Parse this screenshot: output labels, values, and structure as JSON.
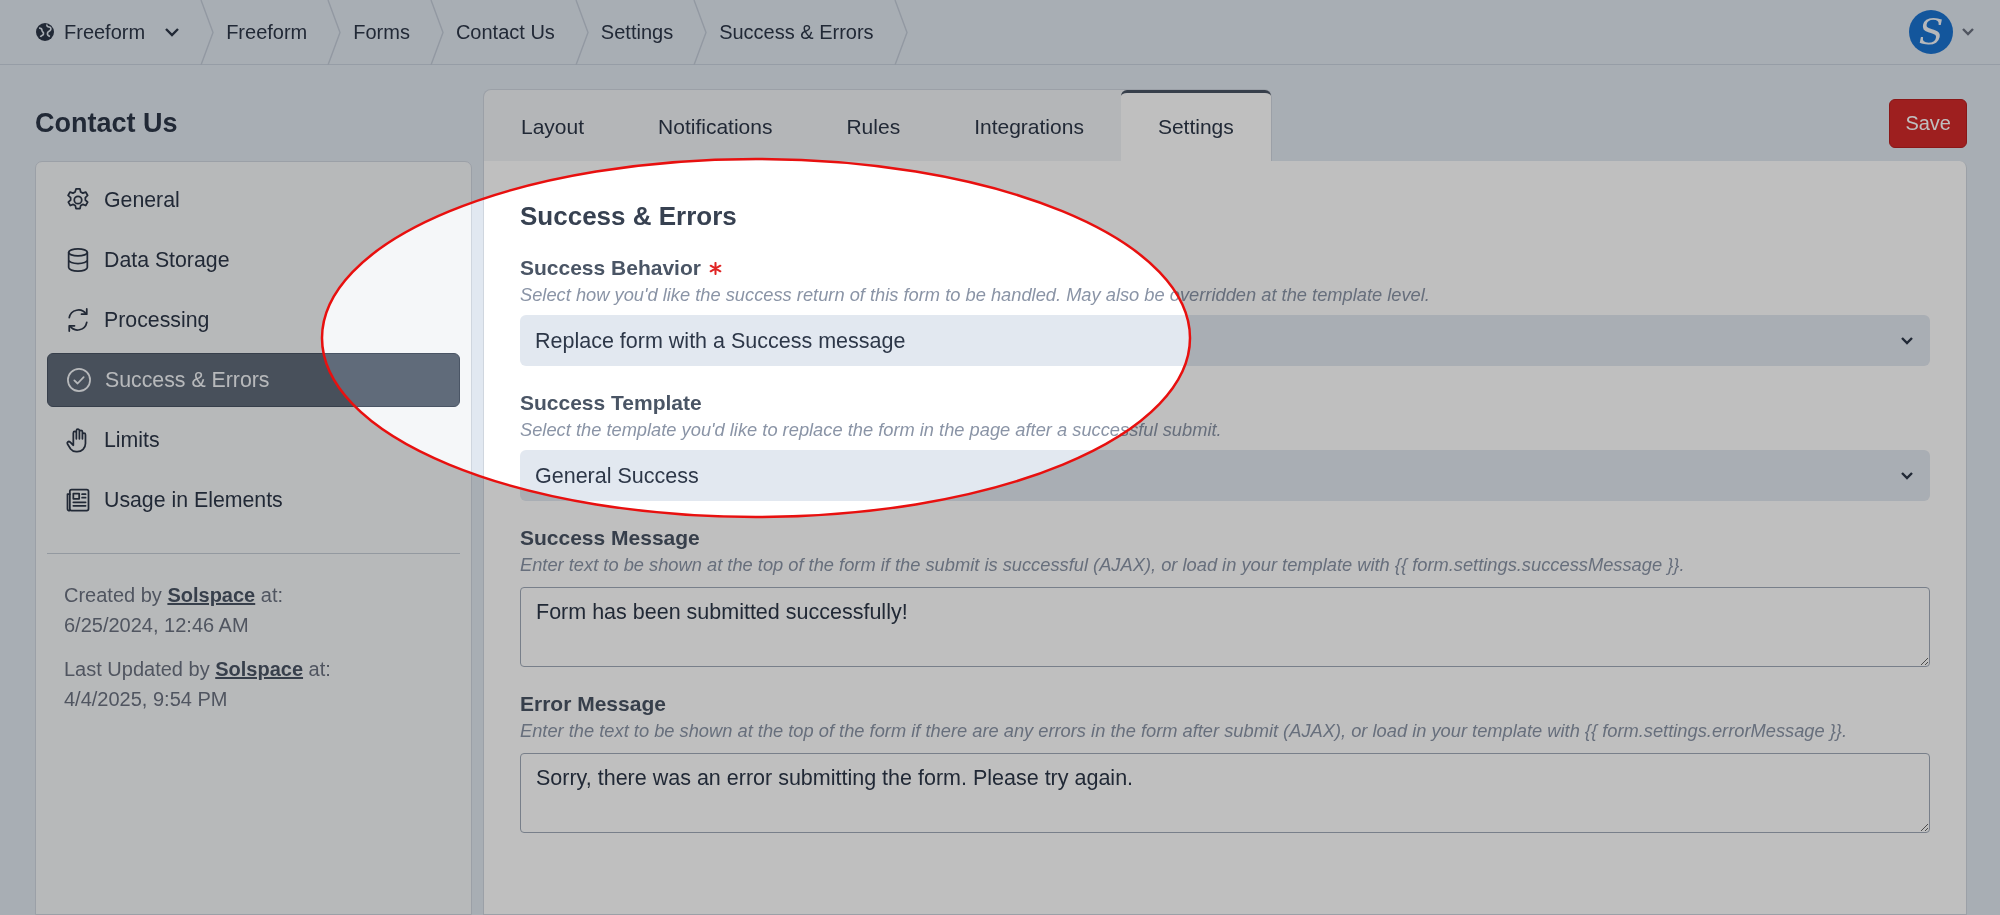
{
  "breadcrumbs": [
    {
      "kind": "site",
      "label": "Freeform"
    },
    {
      "kind": "crumb",
      "label": "Freeform"
    },
    {
      "kind": "crumb",
      "label": "Forms"
    },
    {
      "kind": "crumb",
      "label": "Contact Us"
    },
    {
      "kind": "crumb",
      "label": "Settings"
    },
    {
      "kind": "crumb",
      "label": "Success & Errors"
    }
  ],
  "user": {
    "avatar": "S"
  },
  "page_title": "Contact Us",
  "sidebar": {
    "items": [
      {
        "label": "General",
        "selected": false
      },
      {
        "label": "Data Storage",
        "selected": false
      },
      {
        "label": "Processing",
        "selected": false
      },
      {
        "label": "Success & Errors",
        "selected": true
      },
      {
        "label": "Limits",
        "selected": false
      },
      {
        "label": "Usage in Elements",
        "selected": false
      }
    ],
    "meta": [
      {
        "prefix": "Created by",
        "author": "Solspace",
        "suffix": "at:",
        "date": "6/25/2024, 12:46 AM"
      },
      {
        "prefix": "Last Updated by",
        "author": "Solspace",
        "suffix": "at:",
        "date": "4/4/2025, 9:54 PM"
      }
    ]
  },
  "tabs": [
    {
      "label": "Layout",
      "selected": false
    },
    {
      "label": "Notifications",
      "selected": false
    },
    {
      "label": "Rules",
      "selected": false
    },
    {
      "label": "Integrations",
      "selected": false
    },
    {
      "label": "Settings",
      "selected": true
    }
  ],
  "save_button": "Save",
  "section": {
    "title": "Success & Errors",
    "fields": [
      {
        "kind": "select",
        "label": "Success Behavior",
        "required": true,
        "hint": "Select how you'd like the success return of this form to be handled. May also be overridden at the template level.",
        "value": "Replace form with a Success message"
      },
      {
        "kind": "select",
        "label": "Success Template",
        "required": false,
        "hint": "Select the template you'd like to replace the form in the page after a successful submit.",
        "value": "General Success"
      },
      {
        "kind": "textarea",
        "label": "Success Message",
        "required": false,
        "hint": "Enter text to be shown at the top of the form if the submit is successful (AJAX), or load in your template with {{ form.settings.successMessage }}.",
        "value": "Form has been submitted successfully!"
      },
      {
        "kind": "textarea",
        "label": "Error Message",
        "required": false,
        "hint": "Enter the text to be shown at the top of the form if there are any errors in the form after submit (AJAX), or load in your template with {{ form.settings.errorMessage }}.",
        "value": "Sorry, there was an error submitting the form. Please try again."
      }
    ]
  }
}
